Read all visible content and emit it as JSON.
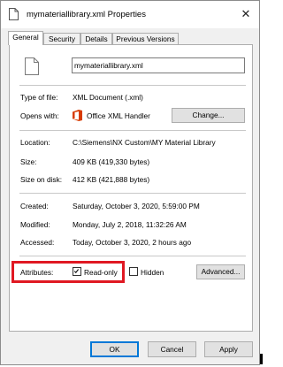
{
  "window": {
    "title": "mymateriallibrary.xml Properties",
    "close": "✕"
  },
  "tabs": [
    "General",
    "Security",
    "Details",
    "Previous Versions"
  ],
  "general": {
    "file_name": "mymateriallibrary.xml",
    "type_label": "Type of file:",
    "type_value": "XML Document (.xml)",
    "opens_label": "Opens with:",
    "opens_value": "Office XML Handler",
    "change_button": "Change...",
    "location_label": "Location:",
    "location_value": "C:\\Siemens\\NX Custom\\MY Material Library",
    "size_label": "Size:",
    "size_value": "409 KB (419,330 bytes)",
    "size_on_disk_label": "Size on disk:",
    "size_on_disk_value": "412 KB (421,888 bytes)",
    "created_label": "Created:",
    "created_value": "Saturday, October 3, 2020, 5:59:00 PM",
    "modified_label": "Modified:",
    "modified_value": "Monday, July 2, 2018, 11:32:26 AM",
    "accessed_label": "Accessed:",
    "accessed_value": "Today, October 3, 2020, 2 hours ago",
    "attributes_label": "Attributes:",
    "readonly_label": "Read-only",
    "readonly_checked": true,
    "hidden_label": "Hidden",
    "hidden_checked": false,
    "advanced_button": "Advanced..."
  },
  "footer": {
    "ok": "OK",
    "cancel": "Cancel",
    "apply": "Apply"
  },
  "colors": {
    "highlight": "#e01822",
    "office_icon": "#d83b01",
    "accent": "#0078d7"
  },
  "icons": [
    "document-icon",
    "office-icon",
    "checkmark-icon",
    "close-icon"
  ]
}
